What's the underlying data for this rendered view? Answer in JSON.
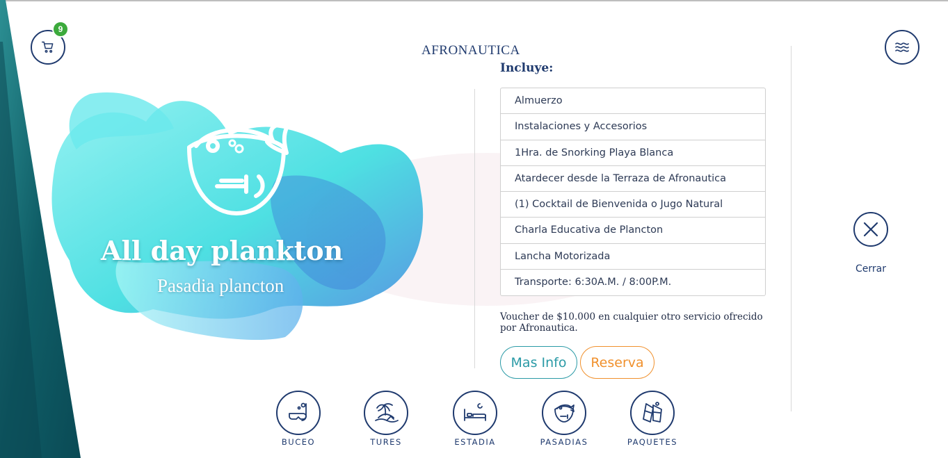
{
  "brand": {
    "logo_text": "AFRONAUTICA"
  },
  "header": {
    "cart_count": "9"
  },
  "hero": {
    "title": "All day plankton",
    "subtitle": "Pasadia plancton"
  },
  "details": {
    "includes_title": "Incluye:",
    "items": [
      "Almuerzo",
      "Instalaciones y Accesorios",
      "1Hra. de Snorking Playa Blanca",
      "Atardecer desde la Terraza de Afronautica",
      "(1) Cocktail de Bienvenida o Jugo Natural",
      "Charla Educativa de Plancton",
      "Lancha Motorizada",
      "Transporte: 6:30A.M. / 8:00P.M."
    ],
    "voucher_text": "Voucher de $10.000 en cualquier otro servicio ofrecido por Afronautica.",
    "more_info_label": "Mas Info",
    "reserve_label": "Reserva"
  },
  "close": {
    "label": "Cerrar"
  },
  "nav": {
    "items": [
      {
        "label": "BUCEO",
        "icon": "snorkel-mask-icon"
      },
      {
        "label": "TURES",
        "icon": "island-palm-icon"
      },
      {
        "label": "ESTADIA",
        "icon": "bed-icon"
      },
      {
        "label": "PASADIAS",
        "icon": "fish-plate-icon"
      },
      {
        "label": "PAQUETES",
        "icon": "fins-icon"
      }
    ]
  },
  "colors": {
    "primary": "#1f3a6e",
    "accent_teal": "#2a9aa6",
    "accent_orange": "#f0902c",
    "badge": "#3caa3c",
    "stripe_teal": "#0f5d66"
  }
}
